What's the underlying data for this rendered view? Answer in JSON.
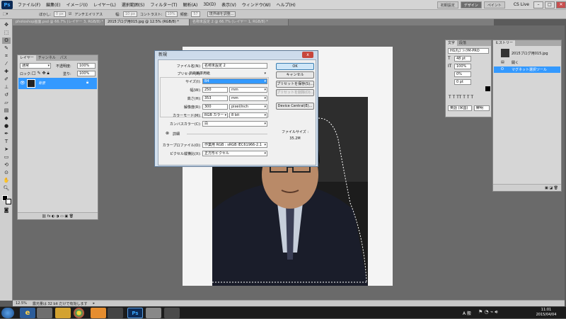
{
  "menubar": {
    "logo": "Ps",
    "items": [
      "ファイル(F)",
      "編集(E)",
      "イメージ(I)",
      "レイヤー(L)",
      "選択範囲(S)",
      "フィルター(T)",
      "解析(A)",
      "3D(D)",
      "表示(V)",
      "ウィンドウ(W)",
      "ヘルプ(H)"
    ],
    "workspaces": [
      "初期設定",
      "デザイン",
      "ペイント"
    ],
    "active_workspace": "デザイン",
    "cslive": "CS Live"
  },
  "options": {
    "feather_label": "ぼかし:",
    "feather_value": "0 px",
    "antialias": "アンチエイリアス",
    "width_label": "幅:",
    "width_value": "10 px",
    "contrast_label": "コントラスト:",
    "contrast_value": "10%",
    "freq_label": "頻度:",
    "freq_value": "57",
    "refine_button": "境界線を調整..."
  },
  "doc_tabs": [
    {
      "label": "photoshop画面.psd @ 66.7% (レイヤー 3, RGB/8) *",
      "active": false
    },
    {
      "label": "2015ブログ用015.jpg @ 12.5% (RGB/8) *",
      "active": true
    },
    {
      "label": "名称未設定 2 @ 66.7% (レイヤー 1, RGB/8) *",
      "active": false
    }
  ],
  "status": {
    "zoom": "12.5%",
    "message": "露光量は 32 bit だけで有効します"
  },
  "layers_panel": {
    "tabs": [
      "レイヤー",
      "チャンネル",
      "パス"
    ],
    "blend_mode": "通常",
    "opacity_label": "不透明度:",
    "opacity_value": "100%",
    "lock_label": "ロック:",
    "fill_label": "塗り:",
    "fill_value": "100%",
    "layer_name": "背景"
  },
  "char_panel": {
    "tabs": [
      "文字",
      "段落"
    ],
    "font": "HG丸ｺﾞｼｯｸM-PRO",
    "size": "48 pt",
    "leading": "100%",
    "tracking": "0%",
    "baseline": "0 pt",
    "language": "英語 (米国)",
    "aa": "鮮明"
  },
  "history_panel": {
    "tab": "ヒストリー",
    "snapshot": "2015ブログ用015.jpg",
    "items": [
      "開く",
      "マグネット選択ツール"
    ]
  },
  "dialog": {
    "title": "新規",
    "close": "x",
    "name_label": "ファイル名(N):",
    "name_value": "名称未設定 2",
    "preset_label": "プリセット(P):",
    "preset_value": "日本標準用紙",
    "size_label": "サイズ(I):",
    "size_value": "B4",
    "width_label": "幅(W):",
    "width_value": "250",
    "width_unit": "mm",
    "height_label": "高さ(H):",
    "height_value": "353",
    "height_unit": "mm",
    "res_label": "解像度(R):",
    "res_value": "300",
    "res_unit": "pixel/inch",
    "mode_label": "カラーモード(M):",
    "mode_value": "RGB カラー",
    "bit_value": "8 bit",
    "bg_label": "カンバスカラー(C):",
    "bg_value": "白",
    "detail_label": "詳細",
    "profile_label": "カラープロファイル(O):",
    "profile_value": "作業用 RGB : sRGB IEC61966-2.1",
    "pixel_label": "ピクセル縦横比(X):",
    "pixel_value": "正方形ピクセル",
    "ok": "OK",
    "cancel": "キャンセル",
    "save_preset": "プリセットを保存(S)...",
    "delete_preset": "プリセットを削除(D)...",
    "device_central": "Device Central(E)...",
    "file_size_label": "ファイルサイズ :",
    "file_size_value": "35.2M"
  },
  "taskbar": {
    "time": "11:01",
    "date": "2015/04/04",
    "tray_icons": [
      "A 般"
    ]
  },
  "colors": {
    "selection": "#3399ff",
    "dialog_frame": "#d4e1ef",
    "accent": "#1f6bd1"
  }
}
